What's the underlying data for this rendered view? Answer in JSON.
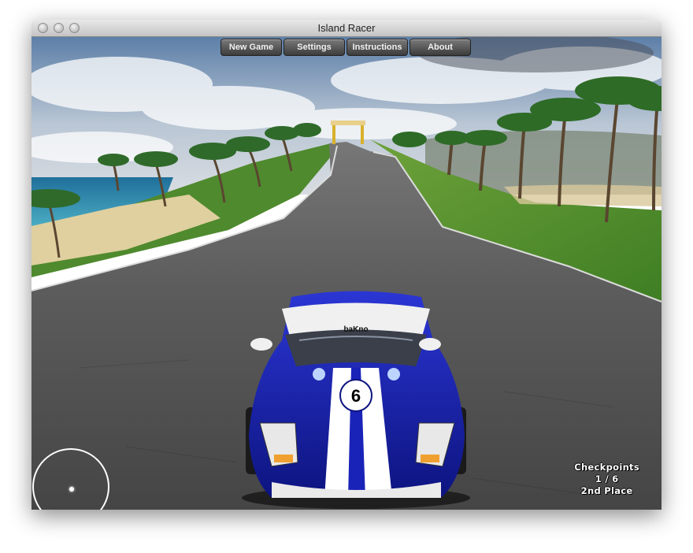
{
  "window": {
    "title": "Island Racer"
  },
  "menu": {
    "items": [
      "New Game",
      "Settings",
      "Instructions",
      "About"
    ]
  },
  "hud": {
    "checkpoints_label": "Checkpoints",
    "checkpoints_value": "1 / 6",
    "place": "2nd Place"
  },
  "car": {
    "number": "6",
    "hood_text": "baKno",
    "colors": {
      "body": "#1a23b8",
      "stripe": "#ffffff"
    }
  },
  "colors": {
    "sky": "#8fa8c4",
    "road": "#585858",
    "grass": "#4c8a2c",
    "sand": "#e4d3a4",
    "sea": "#2f8fb4"
  }
}
